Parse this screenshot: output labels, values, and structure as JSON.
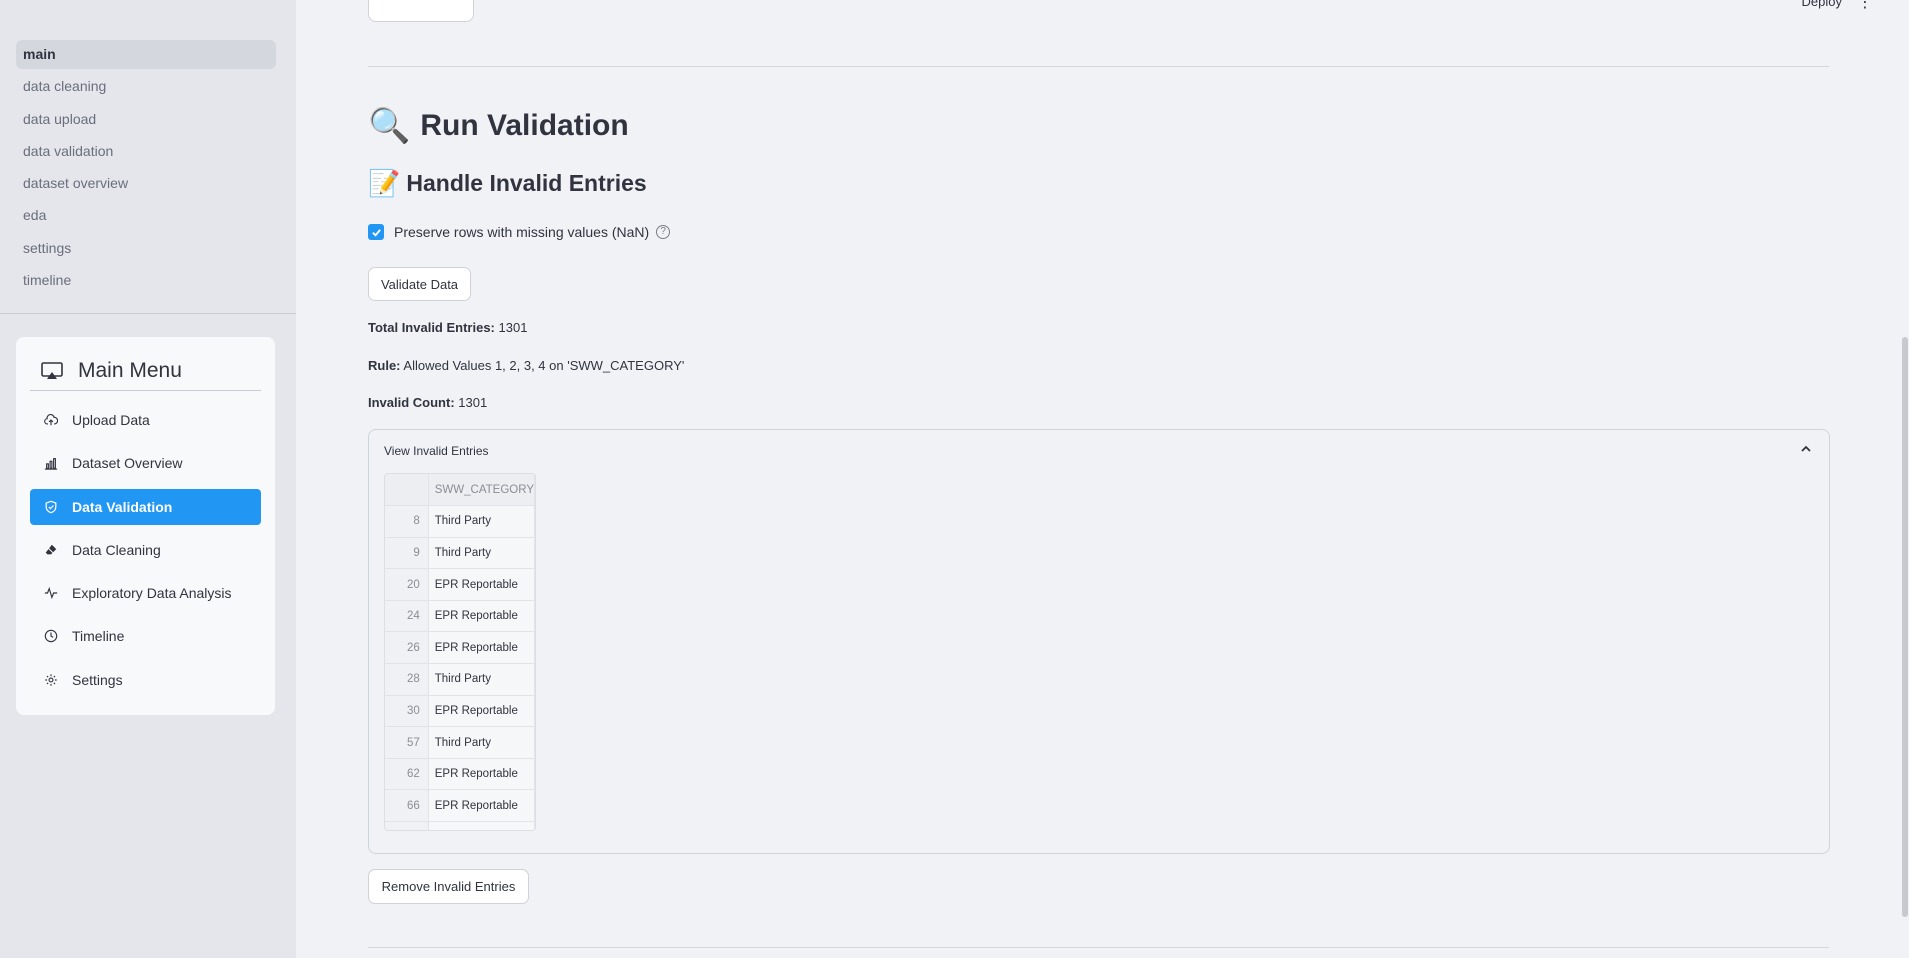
{
  "page_nav": {
    "items": [
      {
        "label": "main",
        "active": true
      },
      {
        "label": "data cleaning",
        "active": false
      },
      {
        "label": "data upload",
        "active": false
      },
      {
        "label": "data validation",
        "active": false
      },
      {
        "label": "dataset overview",
        "active": false
      },
      {
        "label": "eda",
        "active": false
      },
      {
        "label": "settings",
        "active": false
      },
      {
        "label": "timeline",
        "active": false
      }
    ]
  },
  "main_menu": {
    "title": "Main Menu",
    "icon": "airplay-icon",
    "accent_color": "#2196f3",
    "items": [
      {
        "label": "Upload Data",
        "icon": "cloud-upload-icon",
        "active": false
      },
      {
        "label": "Dataset Overview",
        "icon": "bar-chart-icon",
        "active": false
      },
      {
        "label": "Data Validation",
        "icon": "shield-check-icon",
        "active": true
      },
      {
        "label": "Data Cleaning",
        "icon": "eraser-icon",
        "active": false
      },
      {
        "label": "Exploratory Data Analysis",
        "icon": "activity-icon",
        "active": false
      },
      {
        "label": "Timeline",
        "icon": "clock-icon",
        "active": false
      },
      {
        "label": "Settings",
        "icon": "gear-icon",
        "active": false
      }
    ]
  },
  "header": {
    "deploy_label": "Deploy",
    "menu_icon": "kebab-icon"
  },
  "content": {
    "run_validation_title": "Run Validation",
    "run_validation_emoji": "🔍",
    "handle_invalid_title": "Handle Invalid Entries",
    "handle_invalid_emoji": "📝",
    "preserve_checkbox": {
      "label": "Preserve rows with missing values (NaN)",
      "checked": true,
      "help_icon": "question-circle-icon"
    },
    "validate_button": "Validate Data",
    "total_invalid": {
      "label": "Total Invalid Entries:",
      "value": "1301"
    },
    "rule": {
      "label": "Rule:",
      "value": "Allowed Values 1, 2, 3, 4 on 'SWW_CATEGORY'"
    },
    "invalid_count": {
      "label": "Invalid Count:",
      "value": "1301"
    },
    "expander": {
      "label": "View Invalid Entries",
      "expanded": true,
      "table": {
        "columns": [
          "",
          "SWW_CATEGORY"
        ],
        "rows": [
          {
            "index": "8",
            "value": "Third Party"
          },
          {
            "index": "9",
            "value": "Third Party"
          },
          {
            "index": "20",
            "value": "EPR Reportable"
          },
          {
            "index": "24",
            "value": "EPR Reportable"
          },
          {
            "index": "26",
            "value": "EPR Reportable"
          },
          {
            "index": "28",
            "value": "Third Party"
          },
          {
            "index": "30",
            "value": "EPR Reportable"
          },
          {
            "index": "57",
            "value": "Third Party"
          },
          {
            "index": "62",
            "value": "EPR Reportable"
          },
          {
            "index": "66",
            "value": "EPR Reportable"
          }
        ]
      }
    },
    "remove_button": "Remove Invalid Entries"
  }
}
